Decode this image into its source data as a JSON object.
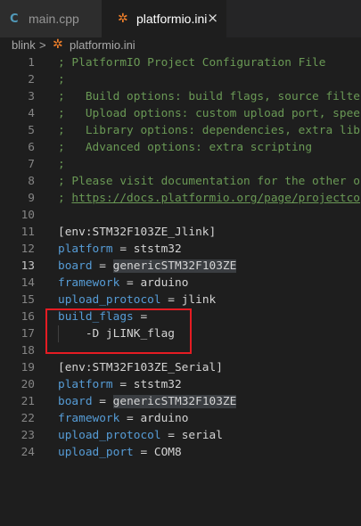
{
  "tabs": [
    {
      "label": "main.cpp",
      "icon": "cpp-file-icon",
      "active": false
    },
    {
      "label": "platformio.ini",
      "icon": "platformio-file-icon",
      "active": true
    }
  ],
  "close_icon": "×",
  "breadcrumb": {
    "folder": "blink",
    "separator": ">",
    "file": "platformio.ini"
  },
  "lines": [
    {
      "n": "1",
      "text": "; PlatformIO Project Configuration File"
    },
    {
      "n": "2",
      "text": ";"
    },
    {
      "n": "3",
      "text": ";   Build options: build flags, source filte"
    },
    {
      "n": "4",
      "text": ";   Upload options: custom upload port, spee"
    },
    {
      "n": "5",
      "text": ";   Library options: dependencies, extra lib"
    },
    {
      "n": "6",
      "text": ";   Advanced options: extra scripting"
    },
    {
      "n": "7",
      "text": ";"
    },
    {
      "n": "8",
      "text": "; Please visit documentation for the other o"
    },
    {
      "n": "9",
      "prefix": "; ",
      "link": "https://docs.platformio.org/page/projectco"
    },
    {
      "n": "10",
      "text": ""
    },
    {
      "n": "11",
      "text": "[env:STM32F103ZE_Jlink]"
    },
    {
      "n": "12",
      "key": "platform",
      "eq": " = ",
      "value": "ststm32"
    },
    {
      "n": "13",
      "key": "board",
      "eq": " = ",
      "value": "genericSTM32F103ZE"
    },
    {
      "n": "14",
      "key": "framework",
      "eq": " = ",
      "value": "arduino"
    },
    {
      "n": "15",
      "key": "upload_protocol",
      "eq": " = ",
      "value": "jlink"
    },
    {
      "n": "16",
      "key": "build_flags",
      "eq": " =",
      "value": ""
    },
    {
      "n": "17",
      "text": "    -D jLINK_flag"
    },
    {
      "n": "18",
      "text": ""
    },
    {
      "n": "19",
      "text": "[env:STM32F103ZE_Serial]"
    },
    {
      "n": "20",
      "key": "platform",
      "eq": " = ",
      "value": "ststm32"
    },
    {
      "n": "21",
      "key": "board",
      "eq": " = ",
      "value": "genericSTM32F103ZE"
    },
    {
      "n": "22",
      "key": "framework",
      "eq": " = ",
      "value": "arduino"
    },
    {
      "n": "23",
      "key": "upload_protocol",
      "eq": " = ",
      "value": "serial"
    },
    {
      "n": "24",
      "key": "upload_port",
      "eq": " = ",
      "value": "COM8"
    }
  ],
  "colors": {
    "comment": "#6a9955",
    "key": "#569cd6",
    "highlight_box": "#e51c23"
  }
}
